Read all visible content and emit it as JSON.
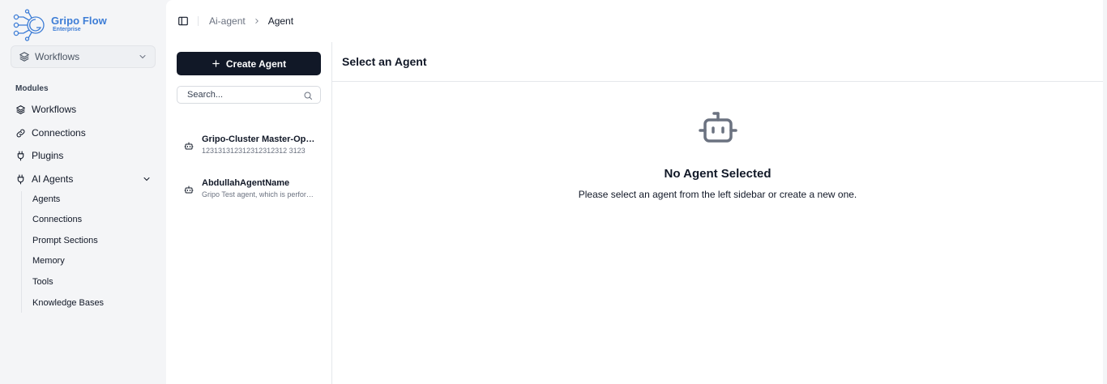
{
  "brand": {
    "name": "Gripo Flow",
    "subtitle": "Enterprise",
    "color": "#3d7dd6"
  },
  "workspace_select": {
    "value": "Workflows",
    "icon": "layers-icon"
  },
  "sidebar": {
    "section_label": "Modules",
    "items": [
      {
        "label": "Workflows",
        "icon": "layers-icon"
      },
      {
        "label": "Connections",
        "icon": "link-icon"
      },
      {
        "label": "Plugins",
        "icon": "plug-icon"
      },
      {
        "label": "AI Agents",
        "icon": "plug-icon",
        "expanded": true
      }
    ],
    "sub_items": [
      {
        "label": "Agents"
      },
      {
        "label": "Connections"
      },
      {
        "label": "Prompt Sections"
      },
      {
        "label": "Memory"
      },
      {
        "label": "Tools"
      },
      {
        "label": "Knowledge Bases"
      }
    ]
  },
  "breadcrumb": {
    "parent": "Ai-agent",
    "current": "Agent"
  },
  "agents_panel": {
    "create_label": "Create Agent",
    "search_placeholder": "Search...",
    "agents": [
      {
        "name": "Gripo-Cluster Master-Operator",
        "description": "123131312312312312312 3123"
      },
      {
        "name": "AbdullahAgentName",
        "description": "Gripo Test agent, which is performing tasks"
      }
    ]
  },
  "detail": {
    "title": "Select an Agent",
    "empty_title": "No Agent Selected",
    "empty_text": "Please select an agent from the left sidebar or create a new one."
  }
}
